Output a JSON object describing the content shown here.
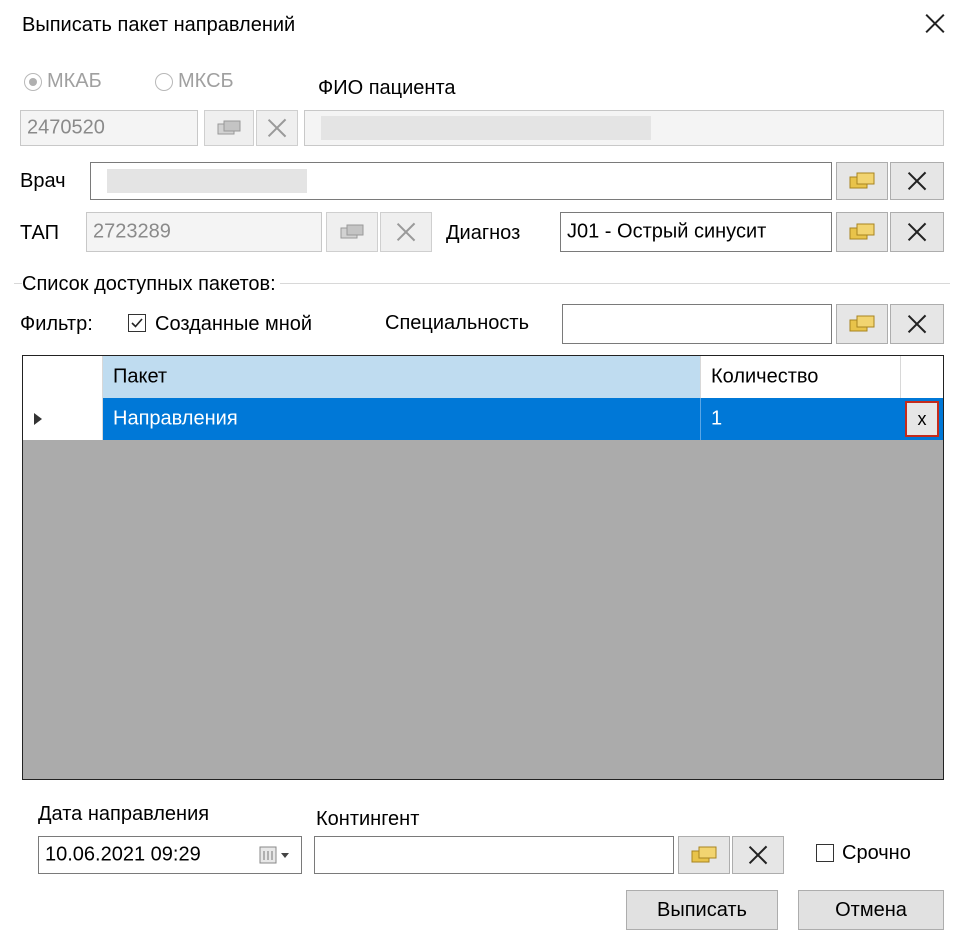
{
  "window": {
    "title": "Выписать пакет направлений"
  },
  "patient": {
    "radio_mkab": "МКАБ",
    "radio_mksb": "МКСБ",
    "fio_label": "ФИО пациента",
    "card_number": "2470520"
  },
  "doctor": {
    "label": "Врач"
  },
  "tap": {
    "label": "ТАП",
    "value": "2723289"
  },
  "diagnosis": {
    "label": "Диагноз",
    "value": "J01 - Острый синусит"
  },
  "packages": {
    "group_label": "Список доступных пакетов:",
    "filter_label": "Фильтр:",
    "created_by_me_label": "Созданные мной",
    "created_by_me_checked": true,
    "specialty_label": "Специальность",
    "columns": [
      "Пакет",
      "Количество"
    ],
    "rows": [
      {
        "name": "Направления",
        "count": "1",
        "delete": "x"
      }
    ]
  },
  "referral": {
    "date_label": "Дата направления",
    "date_value": "10.06.2021 09:29",
    "contingent_label": "Контингент",
    "urgent_label": "Срочно"
  },
  "buttons": {
    "submit": "Выписать",
    "cancel": "Отмена"
  },
  "colors": {
    "selection": "#0078d7",
    "header_bg": "#bfdcf0",
    "grid_empty": "#ababab",
    "highlight": "#c42b1c"
  }
}
